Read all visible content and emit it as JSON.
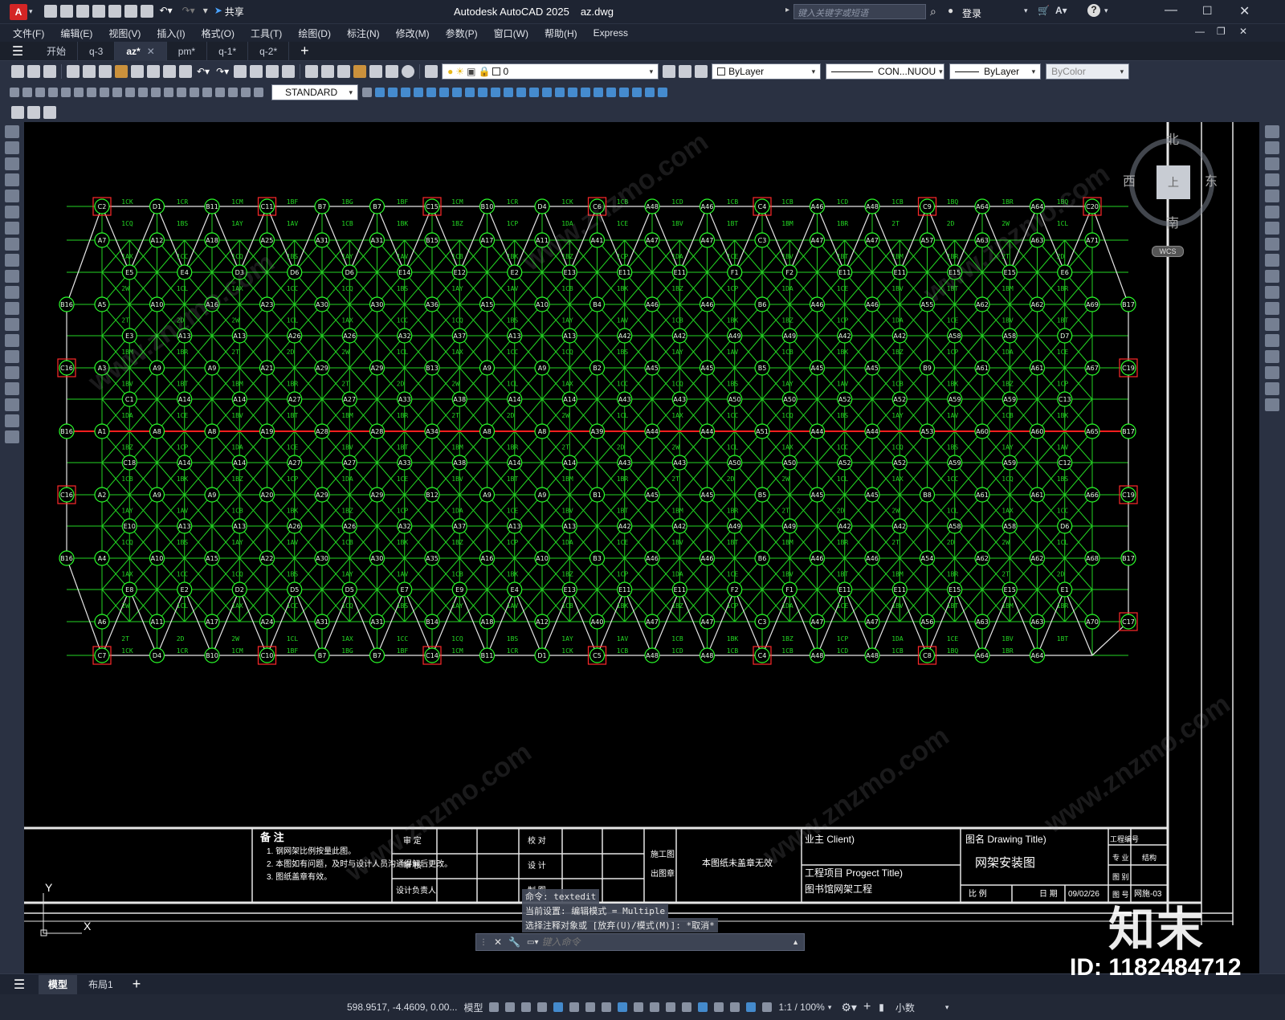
{
  "app": {
    "title": "Autodesk AutoCAD 2025",
    "filename": "az.dwg",
    "search_placeholder": "键入关键字或短语",
    "login": "登录",
    "share": "共享",
    "logo": "A"
  },
  "menu": [
    "文件(F)",
    "编辑(E)",
    "视图(V)",
    "插入(I)",
    "格式(O)",
    "工具(T)",
    "绘图(D)",
    "标注(N)",
    "修改(M)",
    "参数(P)",
    "窗口(W)",
    "帮助(H)",
    "Express"
  ],
  "tabs": [
    {
      "label": "开始",
      "active": false,
      "close": false
    },
    {
      "label": "q-3",
      "active": false,
      "close": false
    },
    {
      "label": "az*",
      "active": true,
      "close": true
    },
    {
      "label": "pm*",
      "active": false,
      "close": false
    },
    {
      "label": "q-1*",
      "active": false,
      "close": false
    },
    {
      "label": "q-2*",
      "active": false,
      "close": false
    }
  ],
  "toolbar": {
    "layer_value": "0",
    "color_value": "ByLayer",
    "linetype_value": "CON...NUOU",
    "lineweight_value": "ByLayer",
    "plotstyle_value": "ByColor",
    "textstyle_value": "STANDARD"
  },
  "viewcube": {
    "north": "北",
    "south": "南",
    "east": "东",
    "west": "西",
    "top": "上",
    "wcs": "WCS"
  },
  "grid": {
    "top_nodes": [
      "C2",
      "D1",
      "B11",
      "C11",
      "B7",
      "B7",
      "C15",
      "B10",
      "D4",
      "C6",
      "A48",
      "A46",
      "C4",
      "A46",
      "A48",
      "C9",
      "A64",
      "A64",
      "C20"
    ],
    "top_bars": [
      "1CK",
      "1CR",
      "1CM",
      "1BF",
      "1BG",
      "1BF",
      "1CM",
      "1CR",
      "1CK",
      "1CB",
      "1CD",
      "1CB",
      "1CB",
      "1CD",
      "1CB",
      "1BQ",
      "1BR",
      "1BQ"
    ],
    "bottom_nodes": [
      "C7",
      "D4",
      "B10",
      "C10",
      "B7",
      "B7",
      "C14",
      "B11",
      "D1",
      "C5",
      "A48",
      "A48",
      "C4",
      "A48",
      "A48",
      "C8",
      "A64",
      "A64"
    ],
    "bottom_bars": [
      "1CK",
      "1CR",
      "1CM",
      "1BF",
      "1BG",
      "1BF",
      "1CM",
      "1CR",
      "1CK",
      "1CB",
      "1CD",
      "1CB",
      "1CB",
      "1CD",
      "1CB",
      "1BQ",
      "1BR"
    ],
    "axis_row": [
      "A1",
      "A8",
      "A8",
      "A19",
      "A28",
      "A28",
      "A34",
      "A8",
      "A8",
      "A39",
      "A44",
      "A44",
      "A51",
      "A44",
      "A44",
      "A53",
      "A60",
      "A60",
      "A65"
    ],
    "left_nodes": [
      "B16",
      "C16",
      "B16",
      "C16",
      "B16"
    ],
    "right_nodes": [
      "B17",
      "C19",
      "B17",
      "C19",
      "B17",
      "C17"
    ],
    "row_nodes": [
      [
        "A7",
        "A12",
        "A18",
        "A25",
        "A31",
        "A31",
        "B15",
        "A17",
        "A11",
        "A41",
        "A47",
        "A47",
        "C3",
        "A47",
        "A47",
        "A57",
        "A63",
        "A63",
        "A71"
      ],
      [
        "E5",
        "E4",
        "D3",
        "D6",
        "D6",
        "E14",
        "E12",
        "E2",
        "E13",
        "E11",
        "E11",
        "F1",
        "F2",
        "E11",
        "E11",
        "E15",
        "E15",
        "E6"
      ],
      [
        "A5",
        "A10",
        "A16",
        "A23",
        "A30",
        "A30",
        "A36",
        "A15",
        "A10",
        "B4",
        "A46",
        "A46",
        "B6",
        "A46",
        "A46",
        "A55",
        "A62",
        "A62",
        "A69"
      ],
      [
        "E3",
        "A13",
        "A13",
        "A26",
        "A26",
        "A32",
        "A37",
        "A13",
        "A13",
        "A42",
        "A42",
        "A49",
        "A49",
        "A42",
        "A42",
        "A58",
        "A58",
        "D7"
      ],
      [
        "A3",
        "A9",
        "A9",
        "A21",
        "A29",
        "A29",
        "B13",
        "A9",
        "A9",
        "B2",
        "A45",
        "A45",
        "B5",
        "A45",
        "A45",
        "B9",
        "A61",
        "A61",
        "A67"
      ],
      [
        "C1",
        "A14",
        "A14",
        "A27",
        "A27",
        "A33",
        "A38",
        "A14",
        "A14",
        "A43",
        "A43",
        "A50",
        "A50",
        "A52",
        "A52",
        "A59",
        "A59",
        "C13"
      ],
      [
        "C18",
        "A14",
        "A14",
        "A27",
        "A27",
        "A33",
        "A38",
        "A14",
        "A14",
        "A43",
        "A43",
        "A50",
        "A50",
        "A52",
        "A52",
        "A59",
        "A59",
        "C12"
      ],
      [
        "A2",
        "A9",
        "A9",
        "A20",
        "A29",
        "A29",
        "B12",
        "A9",
        "A9",
        "B1",
        "A45",
        "A45",
        "B5",
        "A45",
        "A45",
        "B8",
        "A61",
        "A61",
        "A66"
      ],
      [
        "E10",
        "A13",
        "A13",
        "A26",
        "A26",
        "A32",
        "A37",
        "A13",
        "A13",
        "A42",
        "A42",
        "A49",
        "A49",
        "A42",
        "A42",
        "A58",
        "A58",
        "D6"
      ],
      [
        "A4",
        "A10",
        "A15",
        "A22",
        "A30",
        "A30",
        "A35",
        "A16",
        "A10",
        "B3",
        "A46",
        "A46",
        "B6",
        "A46",
        "A46",
        "A54",
        "A62",
        "A62",
        "A68"
      ],
      [
        "E8",
        "E2",
        "D2",
        "D5",
        "D5",
        "E7",
        "E9",
        "E4",
        "E13",
        "E11",
        "E11",
        "F2",
        "F1",
        "E11",
        "E11",
        "E15",
        "E15",
        "E1"
      ],
      [
        "A6",
        "A11",
        "A17",
        "A24",
        "A31",
        "A31",
        "B14",
        "A18",
        "A12",
        "A40",
        "A47",
        "A47",
        "C3",
        "A47",
        "A47",
        "A56",
        "A63",
        "A63",
        "A70"
      ]
    ],
    "bar_codes": [
      "1CQ",
      "1BS",
      "1AY",
      "1AV",
      "1CB",
      "1BK",
      "1BZ",
      "1CP",
      "1DA",
      "1CE",
      "1BV",
      "1BT",
      "1BM",
      "1BR",
      "2T",
      "2D",
      "2W",
      "1CL",
      "1AX",
      "1CC"
    ]
  },
  "title_block": {
    "notes_title": "备 注",
    "notes": [
      "1. 钢网架比例按量此图。",
      "2. 本图如有问题，及时与设计人员沟通得解后更改。",
      "3. 图纸盖章有效。"
    ],
    "review": "审 定",
    "check": "审 核",
    "designer_lead": "设计负责人",
    "proof": "校 对",
    "design": "设 计",
    "draw": "制 图",
    "construction": "施工图",
    "stamp": "出图章",
    "unsealed": "本图纸未盖章无效",
    "client_label": "业主 Client)",
    "project_label": "工程项目 Progect  Title)",
    "project_name": "图书馆网架工程",
    "drawing_label": "图名 Drawing  Title)",
    "drawing_name": "网架安装图",
    "project_no": "工程编号",
    "discipline": "专 业",
    "discipline_val": "结构",
    "sheet_no_label": "图 别",
    "scale_label": "比 例",
    "date_label": "日 期",
    "date_value": "09/02/26",
    "drawing_no_label": "图 号",
    "drawing_no": "网施-03"
  },
  "command": {
    "line1": "命令:  textedit",
    "line2": "当前设置: 编辑模式 = Multiple",
    "line3": "选择注释对象或 [放弃(U)/模式(M)]: *取消*",
    "placeholder": "键入命令"
  },
  "ucs": {
    "x": "X",
    "y": "Y"
  },
  "layout_tabs": {
    "model": "模型",
    "layout1": "布局1",
    "add": "+"
  },
  "status": {
    "coords": "598.9517, -4.4609, 0.00...",
    "model": "模型",
    "scale": "1:1 / 100%",
    "units": "小数"
  },
  "watermark": {
    "text": "www.znzmo.com",
    "brand": "知末",
    "id": "ID: 1182484712"
  },
  "colors": {
    "grid_line": "#23d623",
    "node": "#2aff2a",
    "support": "#ff2a2a",
    "axis": "#ff1e1e",
    "outline": "#e6e6e6",
    "background": "#000000"
  }
}
